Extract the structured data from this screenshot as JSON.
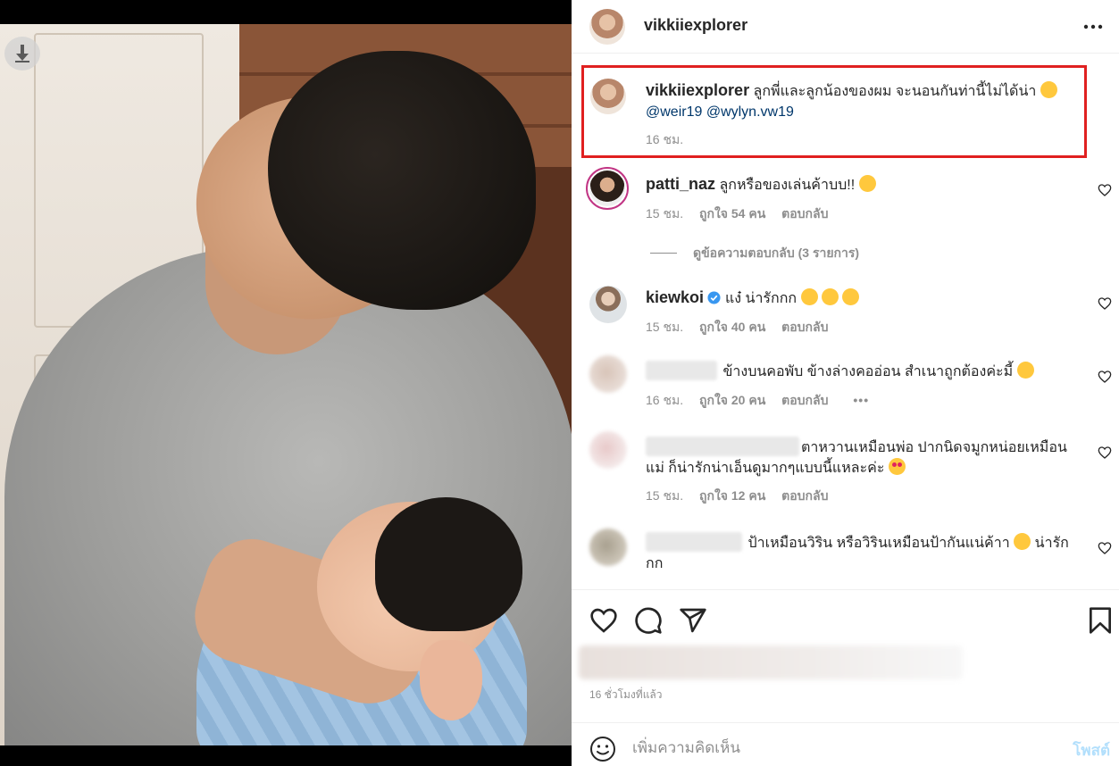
{
  "post": {
    "author": "vikkiiexplorer"
  },
  "caption": {
    "username": "vikkiiexplorer",
    "text": "ลูกพี่และลูกน้องของผม จะนอนกันท่านี้ไม่ได้น่า",
    "mention1": "@weir19",
    "mention2": "@wylyn.vw19",
    "time": "16 ชม."
  },
  "comments": [
    {
      "username": "patti_naz",
      "text": "ลูกหรือของเล่นค้าบบ!!",
      "time": "15 ชม.",
      "likes": "ถูกใจ 54 คน",
      "reply": "ตอบกลับ",
      "view_replies": "ดูข้อความตอบกลับ (3 รายการ)"
    },
    {
      "username": "kiewkoi",
      "text": "แง๋ น่ารักกก",
      "time": "15 ชม.",
      "likes": "ถูกใจ 40 คน",
      "reply": "ตอบกลับ"
    },
    {
      "text": "ข้างบนคอพับ ข้างล่างคออ่อน สำเนาถูกต้องค่ะมี้",
      "time": "16 ชม.",
      "likes": "ถูกใจ 20 คน",
      "reply": "ตอบกลับ",
      "more": "•••"
    },
    {
      "text_line1": "ตาหวานเหมือนพ่อ ปากนิดจมูกหน่อยเหมือน",
      "text_line2": "แม่ ก็น่ารักน่าเอ็นดูมากๆแบบนี้แหละค่ะ",
      "time": "15 ชม.",
      "likes": "ถูกใจ 12 คน",
      "reply": "ตอบกลับ"
    },
    {
      "text_line1": "ป้าเหมือนวิริน หรือวิรินเหมือนป้ากันแน่ค้าา",
      "text_line1b": "น่ารัก",
      "text_line2": "กก"
    }
  ],
  "footer": {
    "timestamp": "16 ชั่วโมงที่แล้ว",
    "comment_placeholder": "เพิ่มความคิดเห็น",
    "post_label": "โพสต์"
  },
  "icons": {
    "download": "download-icon",
    "more": "more-options-icon",
    "like": "heart-icon",
    "comment": "comment-icon",
    "share": "share-icon",
    "save": "bookmark-icon",
    "emoji": "smiley-icon",
    "verified": "verified-badge-icon"
  },
  "colors": {
    "highlight_border": "#e02020",
    "mention": "#00376b",
    "muted": "#8e8e8e",
    "post_button": "#b2dffc",
    "verified": "#3897f0"
  }
}
